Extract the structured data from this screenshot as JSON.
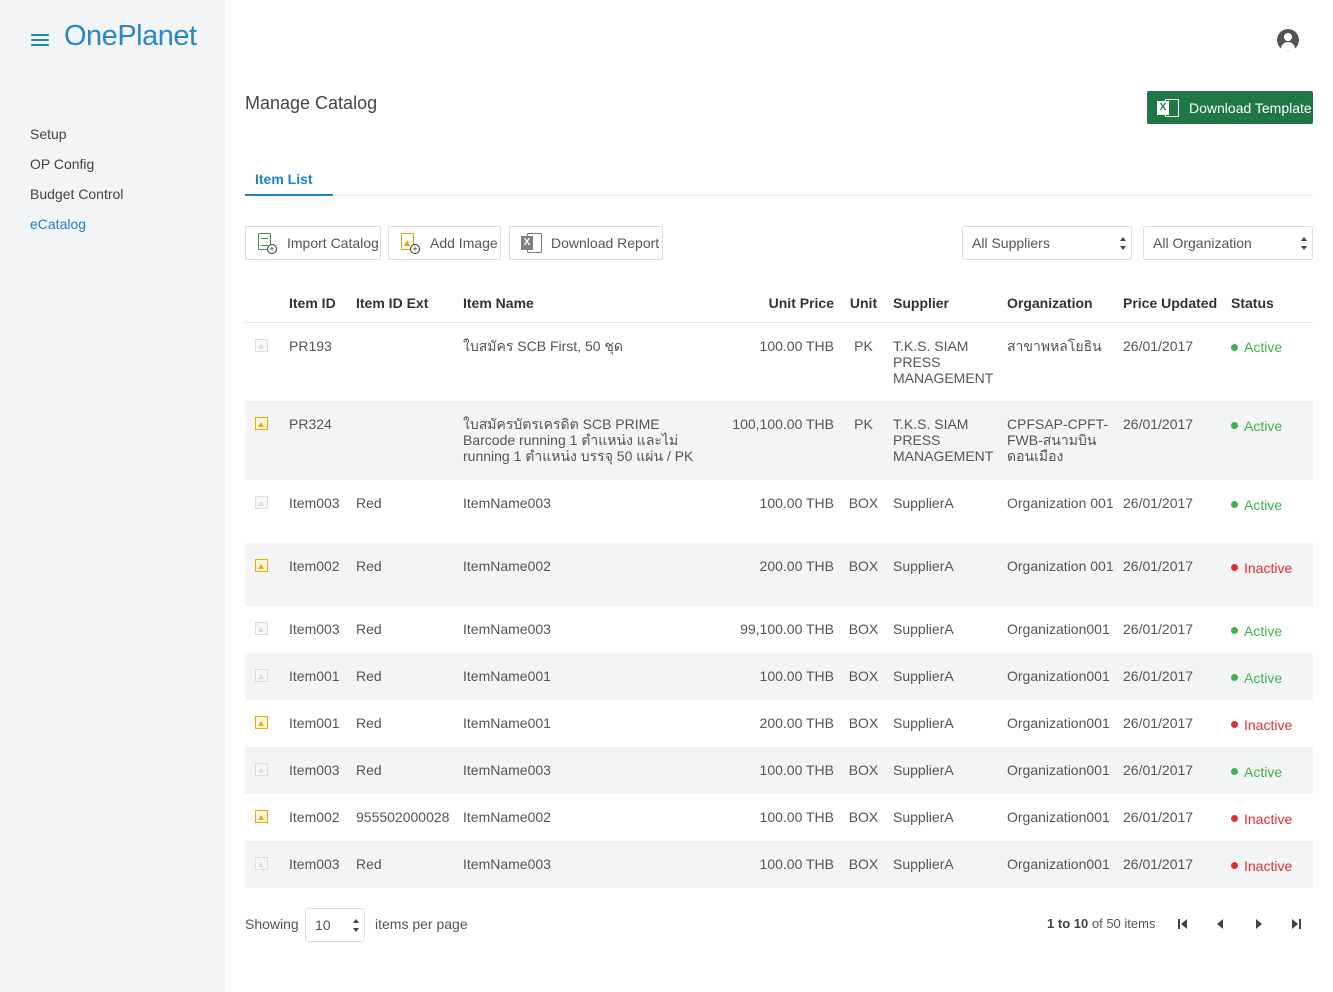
{
  "app": {
    "logo": "OnePlanet"
  },
  "sidebar": {
    "items": [
      {
        "label": "Setup"
      },
      {
        "label": "OP Config"
      },
      {
        "label": "Budget Control"
      },
      {
        "label": "eCatalog"
      }
    ],
    "active": "eCatalog"
  },
  "header": {
    "title": "Manage Catalog",
    "download_template": "Download Template"
  },
  "tabs": [
    {
      "label": "Item List"
    }
  ],
  "toolbar": {
    "import": "Import Catalog",
    "add_image": "Add Image",
    "download_report": "Download Report",
    "supplier_filter": "All Suppliers",
    "org_filter": "All Organization"
  },
  "table": {
    "columns": [
      "Item ID",
      "Item ID Ext",
      "Item Name",
      "Unit Price",
      "Unit",
      "Supplier",
      "Organization",
      "Price Updated",
      "Status"
    ],
    "rows": [
      {
        "image": false,
        "id": "PR193",
        "ext": "",
        "name": "ใบสมัคร SCB First, 50 ชุด",
        "price": "100.00 THB",
        "unit": "PK",
        "supplier": "T.K.S. SIAM PRESS MANAGEMENT",
        "org": "สาขาพหลโยธิน",
        "updated": "26/01/2017",
        "status": "Active"
      },
      {
        "image": true,
        "id": "PR324",
        "ext": "",
        "name": "ใบสมัครบัตรเครดิต SCB PRIME Barcode running 1 ตำแหน่ง และไม่ running 1 ตำแหน่ง บรรจุ 50 แผ่น / PK",
        "price": "100,100.00 THB",
        "unit": "PK",
        "supplier": "T.K.S. SIAM PRESS MANAGEMENT",
        "org": "CPFSAP-CPFT-FWB-สนามบินดอนเมือง",
        "updated": "26/01/2017",
        "status": "Active"
      },
      {
        "image": false,
        "id": "Item003",
        "ext": "Red",
        "name": "ItemName003",
        "price": "100.00 THB",
        "unit": "BOX",
        "supplier": "SupplierA",
        "org": "Organization 001",
        "updated": "26/01/2017",
        "status": "Active"
      },
      {
        "image": true,
        "id": "Item002",
        "ext": "Red",
        "name": "ItemName002",
        "price": "200.00 THB",
        "unit": "BOX",
        "supplier": "SupplierA",
        "org": "Organization 001",
        "updated": "26/01/2017",
        "status": "Inactive"
      },
      {
        "image": false,
        "id": "Item003",
        "ext": "Red",
        "name": "ItemName003",
        "price": "99,100.00 THB",
        "unit": "BOX",
        "supplier": "SupplierA",
        "org": "Organization001",
        "updated": "26/01/2017",
        "status": "Active"
      },
      {
        "image": false,
        "id": "Item001",
        "ext": "Red",
        "name": "ItemName001",
        "price": "100.00 THB",
        "unit": "BOX",
        "supplier": "SupplierA",
        "org": "Organization001",
        "updated": "26/01/2017",
        "status": "Active"
      },
      {
        "image": true,
        "id": "Item001",
        "ext": "Red",
        "name": "ItemName001",
        "price": "200.00 THB",
        "unit": "BOX",
        "supplier": "SupplierA",
        "org": "Organization001",
        "updated": "26/01/2017",
        "status": "Inactive"
      },
      {
        "image": false,
        "id": "Item003",
        "ext": "Red",
        "name": "ItemName003",
        "price": "100.00 THB",
        "unit": "BOX",
        "supplier": "SupplierA",
        "org": "Organization001",
        "updated": "26/01/2017",
        "status": "Active"
      },
      {
        "image": true,
        "id": "Item002",
        "ext": "955502000028",
        "name": "ItemName002",
        "price": "100.00 THB",
        "unit": "BOX",
        "supplier": "SupplierA",
        "org": "Organization001",
        "updated": "26/01/2017",
        "status": "Inactive"
      },
      {
        "image": false,
        "id": "Item003",
        "ext": "Red",
        "name": "ItemName003",
        "price": "100.00 THB",
        "unit": "BOX",
        "supplier": "SupplierA",
        "org": "Organization001",
        "updated": "26/01/2017",
        "status": "Inactive"
      }
    ]
  },
  "footer": {
    "showing": "Showing",
    "per_page": "10",
    "items_per_page": "items per page",
    "range_from": "1",
    "range_to_word": "to",
    "range_to": "10",
    "range_of": "of 50 items"
  },
  "colors": {
    "accent": "#1d83c4",
    "excel_green": "#1e7745",
    "active": "#40b24a",
    "inactive": "#e03030"
  },
  "icons": [
    "menu-icon",
    "user-account-icon",
    "excel-icon",
    "import-file-icon",
    "add-image-icon",
    "excel-report-icon",
    "image-thumbnail-icon",
    "first-page-icon",
    "prev-page-icon",
    "next-page-icon",
    "last-page-icon"
  ]
}
